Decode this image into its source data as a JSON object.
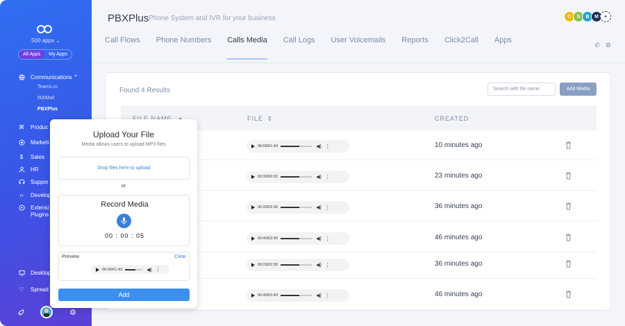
{
  "sidebar": {
    "apps_count": "500 apps ⌄",
    "toggle": [
      "All Apps",
      "My Apps"
    ],
    "items": [
      {
        "label": "Communications ⌃"
      },
      {
        "label": "Produc"
      },
      {
        "label": "Marketi"
      },
      {
        "label": "Sales"
      },
      {
        "label": "HR"
      },
      {
        "label": "Suppor"
      },
      {
        "label": "Develop"
      },
      {
        "label": "Extensi"
      },
      {
        "label": "Plugins"
      },
      {
        "label": "Desktop"
      },
      {
        "label": "Spread"
      }
    ],
    "sub_items": [
      "Teams.cc",
      "500Mail",
      "PBXPlus"
    ]
  },
  "header": {
    "title": "PBXPlus",
    "subtitle": "Phone System and IVR for your business",
    "avatars": [
      {
        "letter": "C",
        "color": "#f5b800"
      },
      {
        "letter": "S",
        "color": "#8bc34a"
      },
      {
        "letter": "B",
        "color": "#2aa6c9"
      },
      {
        "letter": "M",
        "color": "#1f2f5c"
      }
    ]
  },
  "tabs": [
    "Call Flows",
    "Phone Numbers",
    "Calls Media",
    "Call Logs",
    "User Voicemails",
    "Reports",
    "Click2Call",
    "Apps"
  ],
  "content": {
    "results": "Found 4 Results",
    "search_placeholder": "Search with file name",
    "add_media": "Add Media",
    "columns": [
      "FILE NAME",
      "FILE",
      "CREATED"
    ],
    "rows": [
      {
        "time": "00:00/01:43",
        "created": "10 minutes ago"
      },
      {
        "time": "00:30/02:03",
        "created": "23 minutes ago"
      },
      {
        "time": "00:20/02:30",
        "created": "36 minutes ago"
      },
      {
        "time": "00:40/02:43",
        "created": "46 minutes ago"
      },
      {
        "time": "00:20/02:30",
        "created": "36 minutes ago"
      },
      {
        "time": "00:40/02:43",
        "created": "46 minutes ago"
      }
    ]
  },
  "modal": {
    "title": "Upload Your File",
    "subtitle": "Media allows users to upload MP3 files",
    "dropzone": "Drop files here to upload",
    "or": "or",
    "record_title": "Record Media",
    "timer": "00 : 00 : 05",
    "preview_label": "Preview",
    "clear": "Clear",
    "preview_time": "00:00/01:43",
    "add": "Add"
  }
}
